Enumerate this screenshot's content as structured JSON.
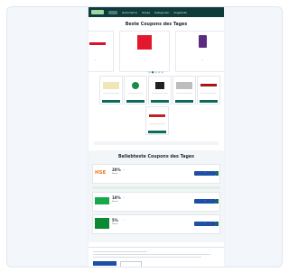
{
  "nav": {
    "links": [
      "Gutscheine",
      "Shops",
      "Kategorien",
      "Angebote",
      "Blog"
    ]
  },
  "hero": {
    "title": "Beste Coupons des Tages",
    "cards": [
      {
        "text": "…",
        "accent": "#d9112b"
      },
      {
        "text": "…",
        "accent": "#e3182c"
      },
      {
        "text": "…",
        "accent": "#5b2b82"
      }
    ]
  },
  "grid": {
    "items": [
      {
        "accent": "#d9c44c"
      },
      {
        "accent": "#1b8a4a"
      },
      {
        "accent": "#222222"
      },
      {
        "accent": "#9a9a9a"
      },
      {
        "accent": "#a01818"
      },
      {
        "accent": "#f28b1f"
      },
      {
        "accent": "#c22222"
      }
    ]
  },
  "section2": {
    "title": "Beliebteste Coupons des Tages",
    "rows": [
      {
        "brand": "HSE",
        "brand_color": "#e07b1d",
        "pct": "20%",
        "pct_label": "Rabatt",
        "desc": "…",
        "btn": "…"
      },
      {
        "brand": "",
        "brand_color": "#16a84b",
        "pct": "10%",
        "pct_label": "Rabatt",
        "desc": "…",
        "btn": "…"
      },
      {
        "brand": "",
        "brand_color": "#0a8a32",
        "pct": "5%",
        "pct_label": "Rabatt",
        "desc": "…",
        "btn": "…"
      }
    ]
  },
  "colors": {
    "nav_bg": "#0f3b3a",
    "primary_button": "#1e4fa6",
    "accent_green": "#0e6b5c"
  }
}
